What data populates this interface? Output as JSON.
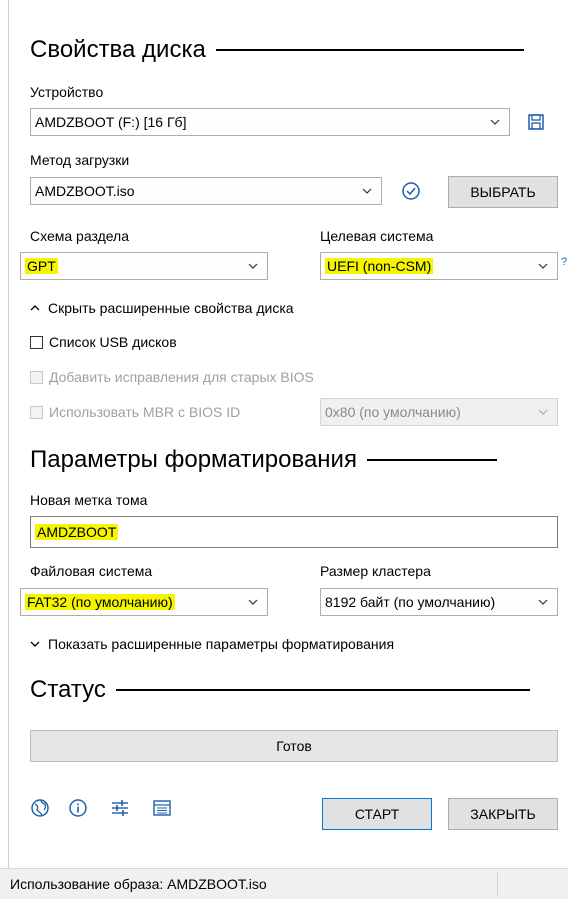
{
  "drive_properties": {
    "title": "Свойства диска",
    "device_label": "Устройство",
    "device_value": "AMDZBOOT (F:) [16 Гб]",
    "boot_method_label": "Метод загрузки",
    "boot_method_value": "AMDZBOOT.iso",
    "select_button": "ВЫБРАТЬ",
    "partition_scheme_label": "Схема раздела",
    "partition_scheme_value": "GPT",
    "target_system_label": "Целевая система",
    "target_system_value": "UEFI (non-CSM)",
    "help_mark": "?",
    "advanced_toggle": "Скрыть расширенные свойства диска",
    "usb_list_checkbox": "Список USB дисков",
    "bios_fixes_checkbox": "Добавить исправления для старых BIOS",
    "mbr_bios_checkbox": "Использовать MBR с BIOS ID",
    "bios_id_value": "0x80 (по умолчанию)"
  },
  "format_options": {
    "title": "Параметры форматирования",
    "volume_label_label": "Новая метка тома",
    "volume_label_value": "AMDZBOOT",
    "filesystem_label": "Файловая система",
    "filesystem_value": "FAT32 (по умолчанию)",
    "cluster_label": "Размер кластера",
    "cluster_value": "8192 байт (по умолчанию)",
    "advanced_toggle": "Показать расширенные параметры форматирования"
  },
  "status": {
    "title": "Статус",
    "progress_text": "Готов"
  },
  "footer": {
    "start_button": "СТАРТ",
    "close_button": "ЗАКРЫТЬ",
    "icons": [
      "globe-icon",
      "info-icon",
      "settings-sliders-icon",
      "log-icon"
    ]
  },
  "statusbar": {
    "text": "Использование образа: AMDZBOOT.iso"
  },
  "colors": {
    "highlight": "#f5f500",
    "accent": "#0078d7",
    "icon_blue": "#1f5fa8"
  }
}
